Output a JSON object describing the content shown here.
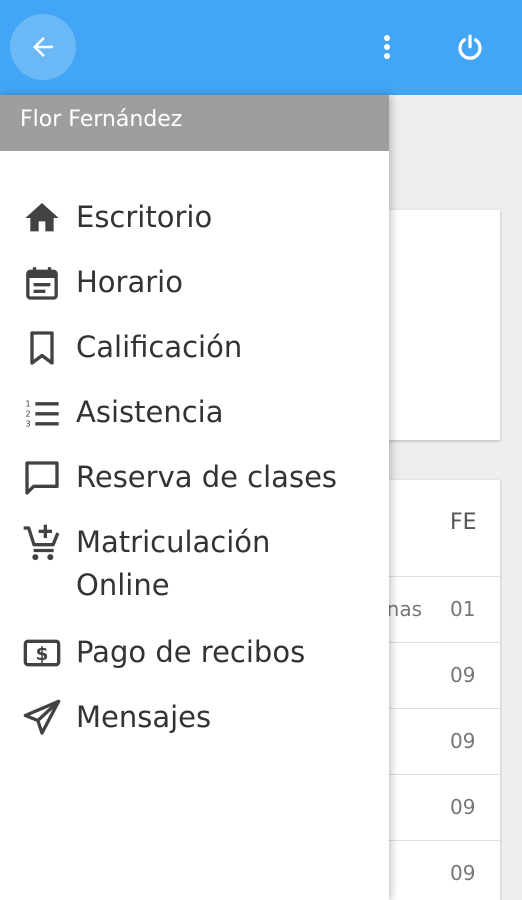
{
  "appbar": {
    "back_icon": "arrow-left-icon",
    "menu_icon": "more-vert-icon",
    "power_icon": "power-icon",
    "color": "#42a5f5"
  },
  "drawer": {
    "user_name": "Flor Fernández",
    "items": [
      {
        "label": "Escritorio",
        "icon": "home-icon"
      },
      {
        "label": "Horario",
        "icon": "calendar-icon"
      },
      {
        "label": "Calificación",
        "icon": "bookmark-icon"
      },
      {
        "label": "Asistencia",
        "icon": "numbered-list-icon"
      },
      {
        "label": "Reserva de clases",
        "icon": "chat-bubble-icon"
      },
      {
        "label": "Matriculación Online",
        "icon": "add-cart-icon"
      },
      {
        "label": "Pago de recibos",
        "icon": "payment-icon"
      },
      {
        "label": "Mensajes",
        "icon": "send-icon"
      }
    ]
  },
  "background": {
    "table_header": "FE",
    "rows": [
      {
        "c1": "nas",
        "c2": "01"
      },
      {
        "c1": "",
        "c2": "09"
      },
      {
        "c1": "",
        "c2": "09"
      },
      {
        "c1": "",
        "c2": "09"
      },
      {
        "c1": "",
        "c2": "09"
      }
    ]
  }
}
